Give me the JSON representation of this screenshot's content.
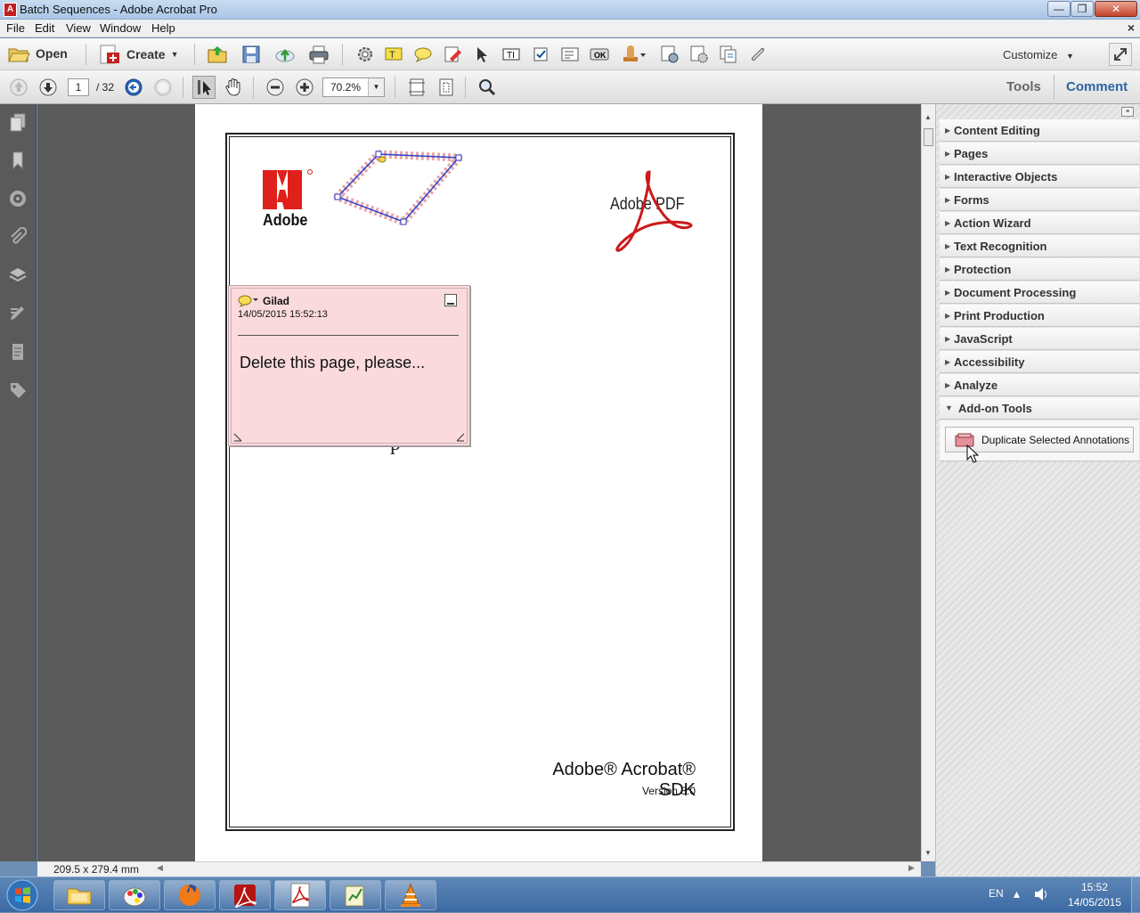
{
  "window": {
    "title": "Batch Sequences - Adobe Acrobat Pro"
  },
  "menu": {
    "items": [
      "File",
      "Edit",
      "View",
      "Window",
      "Help"
    ],
    "close": "×"
  },
  "toolbar": {
    "open_label": "Open",
    "create_label": "Create",
    "customize_label": "Customize"
  },
  "nav": {
    "page_current": "1",
    "page_total": "/ 32",
    "zoom": "70.2%",
    "tools_label": "Tools",
    "comment_label": "Comment"
  },
  "document": {
    "adobe_logo_text": "Adobe",
    "adobe_pdf_text": "Adobe PDF",
    "sdk_title": "Adobe® Acrobat® SDK",
    "sdk_version": "Version 8.0"
  },
  "note": {
    "author": "Gilad",
    "timestamp": "14/05/2015 15:52:13",
    "body": "Delete this page, please..."
  },
  "status": {
    "page_size": "209.5 x 279.4 mm"
  },
  "right_panel": {
    "sections": [
      "Content Editing",
      "Pages",
      "Interactive Objects",
      "Forms",
      "Action Wizard",
      "Text Recognition",
      "Protection",
      "Document Processing",
      "Print Production",
      "JavaScript",
      "Accessibility",
      "Analyze"
    ],
    "expanded_section": "Add-on Tools",
    "addon_button": "Duplicate Selected Annotations"
  },
  "taskbar": {
    "lang": "EN",
    "time": "15:52",
    "date": "14/05/2015"
  }
}
